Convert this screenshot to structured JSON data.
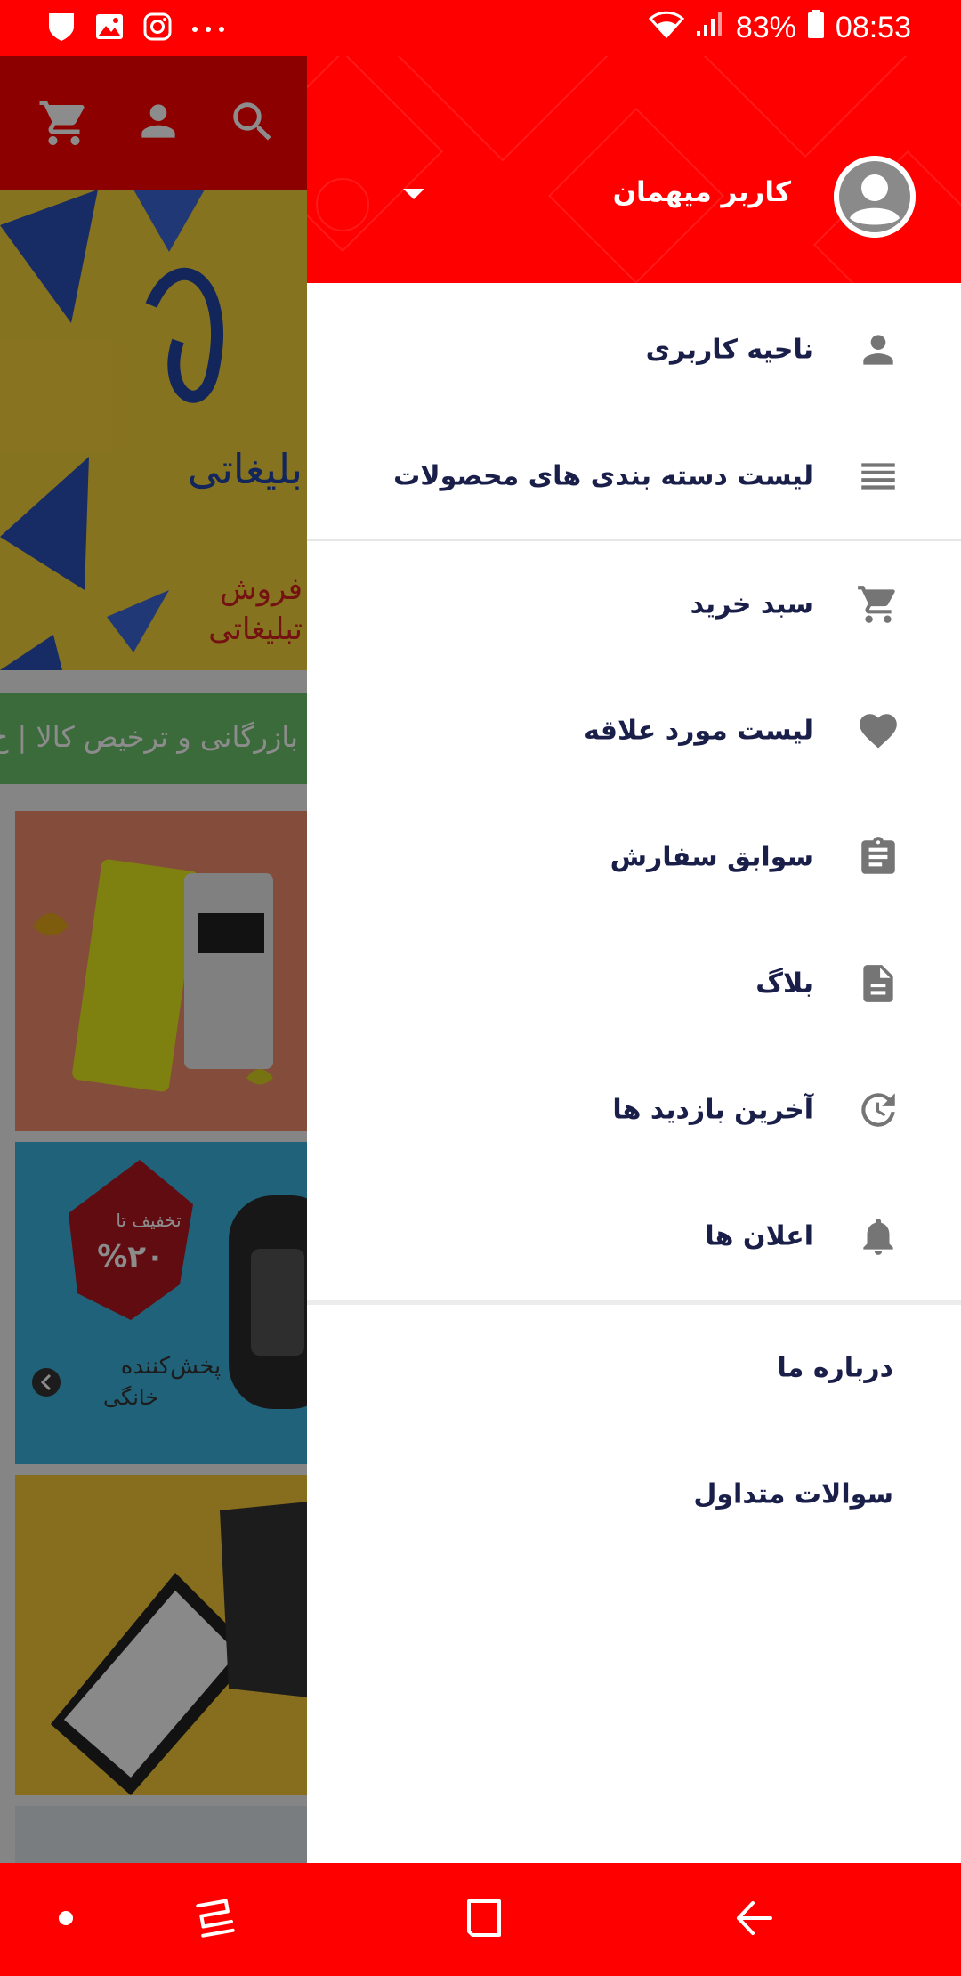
{
  "status_bar": {
    "icons_left": [
      "shield-icon",
      "image-icon",
      "instagram-icon",
      "more-dots-icon"
    ],
    "icons_right": [
      "wifi-icon",
      "signal-icon",
      "battery-icon"
    ],
    "battery": "83%",
    "time": "08:53"
  },
  "background": {
    "toolbar_icons": [
      "cart-icon",
      "account-icon",
      "search-icon"
    ],
    "promo_text": "بازرگانی و ترخیص کالا | خ",
    "card_2_text_1": "پخش‌کننده",
    "card_2_text_2": "خانگی",
    "card_2_badge": "تخفیف تا",
    "card_2_percent": "%۲۰",
    "colors": {
      "banner": "#f5d13b",
      "promo": "#6cc26c"
    }
  },
  "drawer": {
    "header": {
      "user_name": "کاربر میهمان",
      "avatar_icon": "account-circle-icon",
      "dropdown_icon": "arrow-drop-down-icon",
      "color": "#ff0000"
    },
    "menu": [
      {
        "label": "ناحیه کاربری",
        "icon": "person-icon"
      },
      {
        "label": "لیست دسته بندی های محصولات",
        "icon": "list-icon"
      },
      {
        "label": "سبد خرید",
        "icon": "cart-icon"
      },
      {
        "label": "لیست مورد علاقه",
        "icon": "heart-icon"
      },
      {
        "label": "سوابق سفارش",
        "icon": "clipboard-icon"
      },
      {
        "label": "بلاگ",
        "icon": "document-icon"
      },
      {
        "label": "آخرین بازدید ها",
        "icon": "history-icon"
      },
      {
        "label": "اعلان ها",
        "icon": "bell-icon"
      }
    ],
    "extra": [
      {
        "label": "درباره ما"
      },
      {
        "label": "سوالات متداول"
      }
    ]
  },
  "nav_bar": {
    "buttons": [
      "dot-icon",
      "recents-icon",
      "home-icon",
      "back-icon"
    ]
  }
}
